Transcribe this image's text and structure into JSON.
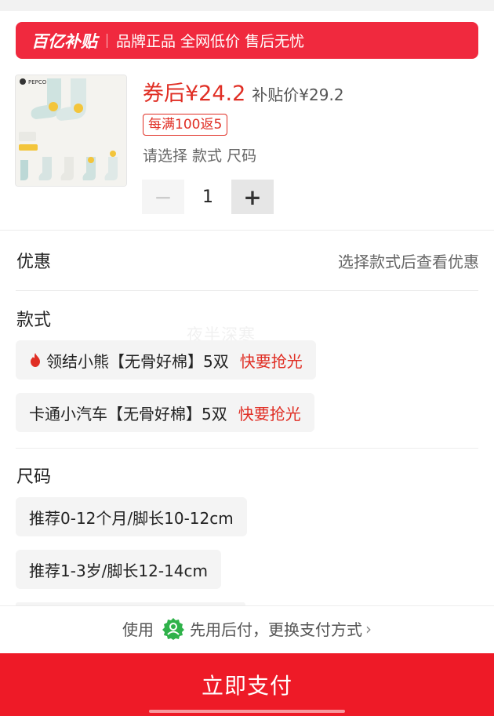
{
  "banner": {
    "logo": "百亿补贴",
    "tagline": "品牌正品 全网低价 售后无忧"
  },
  "product": {
    "thumbnail_icon": "socks-product-image",
    "thumbnail_brand": "PEPCO",
    "price_label": "券后¥24.2",
    "subsidy_price": "补贴价¥29.2",
    "promo_tag": "每满100返5",
    "select_hint": "请选择 款式 尺码",
    "quantity": "1",
    "minus_label": "−",
    "plus_label": "+"
  },
  "discount": {
    "title": "优惠",
    "hint": "选择款式后查看优惠"
  },
  "watermark": "夜半深寒",
  "style_section": {
    "title": "款式",
    "options": [
      {
        "label": "领结小熊【无骨好棉】5双",
        "hot": "快要抢光",
        "icon": "flame-icon"
      },
      {
        "label": "卡通小汽车【无骨好棉】5双",
        "hot": "快要抢光"
      }
    ]
  },
  "size_section": {
    "title": "尺码",
    "options": [
      {
        "label": "推荐0-12个月/脚长10-12cm"
      },
      {
        "label": "推荐1-3岁/脚长12-14cm"
      }
    ]
  },
  "payment": {
    "prefix": "使用",
    "method": "先用后付，更换支付方式",
    "badge_icon": "pay-later-badge-icon",
    "button_label": "立即支付"
  },
  "colors": {
    "accent_red": "#e02e24",
    "banner_red": "#f0293e",
    "button_red": "#ee1a27",
    "badge_green": "#2fb24a"
  }
}
